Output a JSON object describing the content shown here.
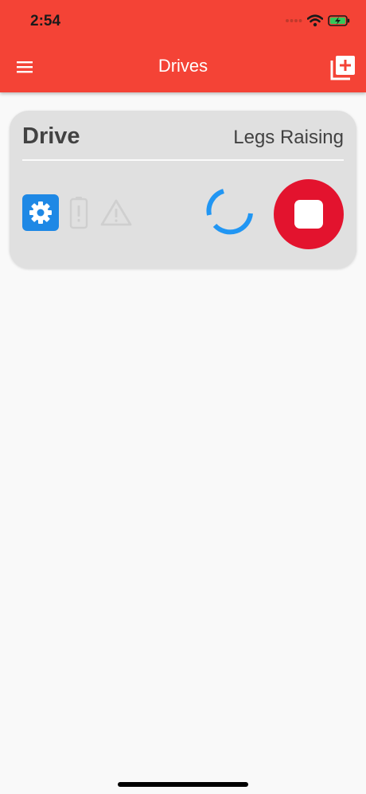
{
  "status_bar": {
    "time": "2:54"
  },
  "app_bar": {
    "title": "Drives",
    "menu_icon": "hamburger-menu-icon",
    "add_icon": "add-to-library-icon",
    "color": "#f44336"
  },
  "drives": [
    {
      "name": "Drive",
      "status": "Legs Raising",
      "settings_icon": "gear-icon",
      "battery_icon": "battery-alert-icon",
      "warning_icon": "warning-icon",
      "loading": true,
      "stop_icon": "stop-icon",
      "stop_color": "#e3132e",
      "settings_color": "#1e88e5"
    }
  ]
}
